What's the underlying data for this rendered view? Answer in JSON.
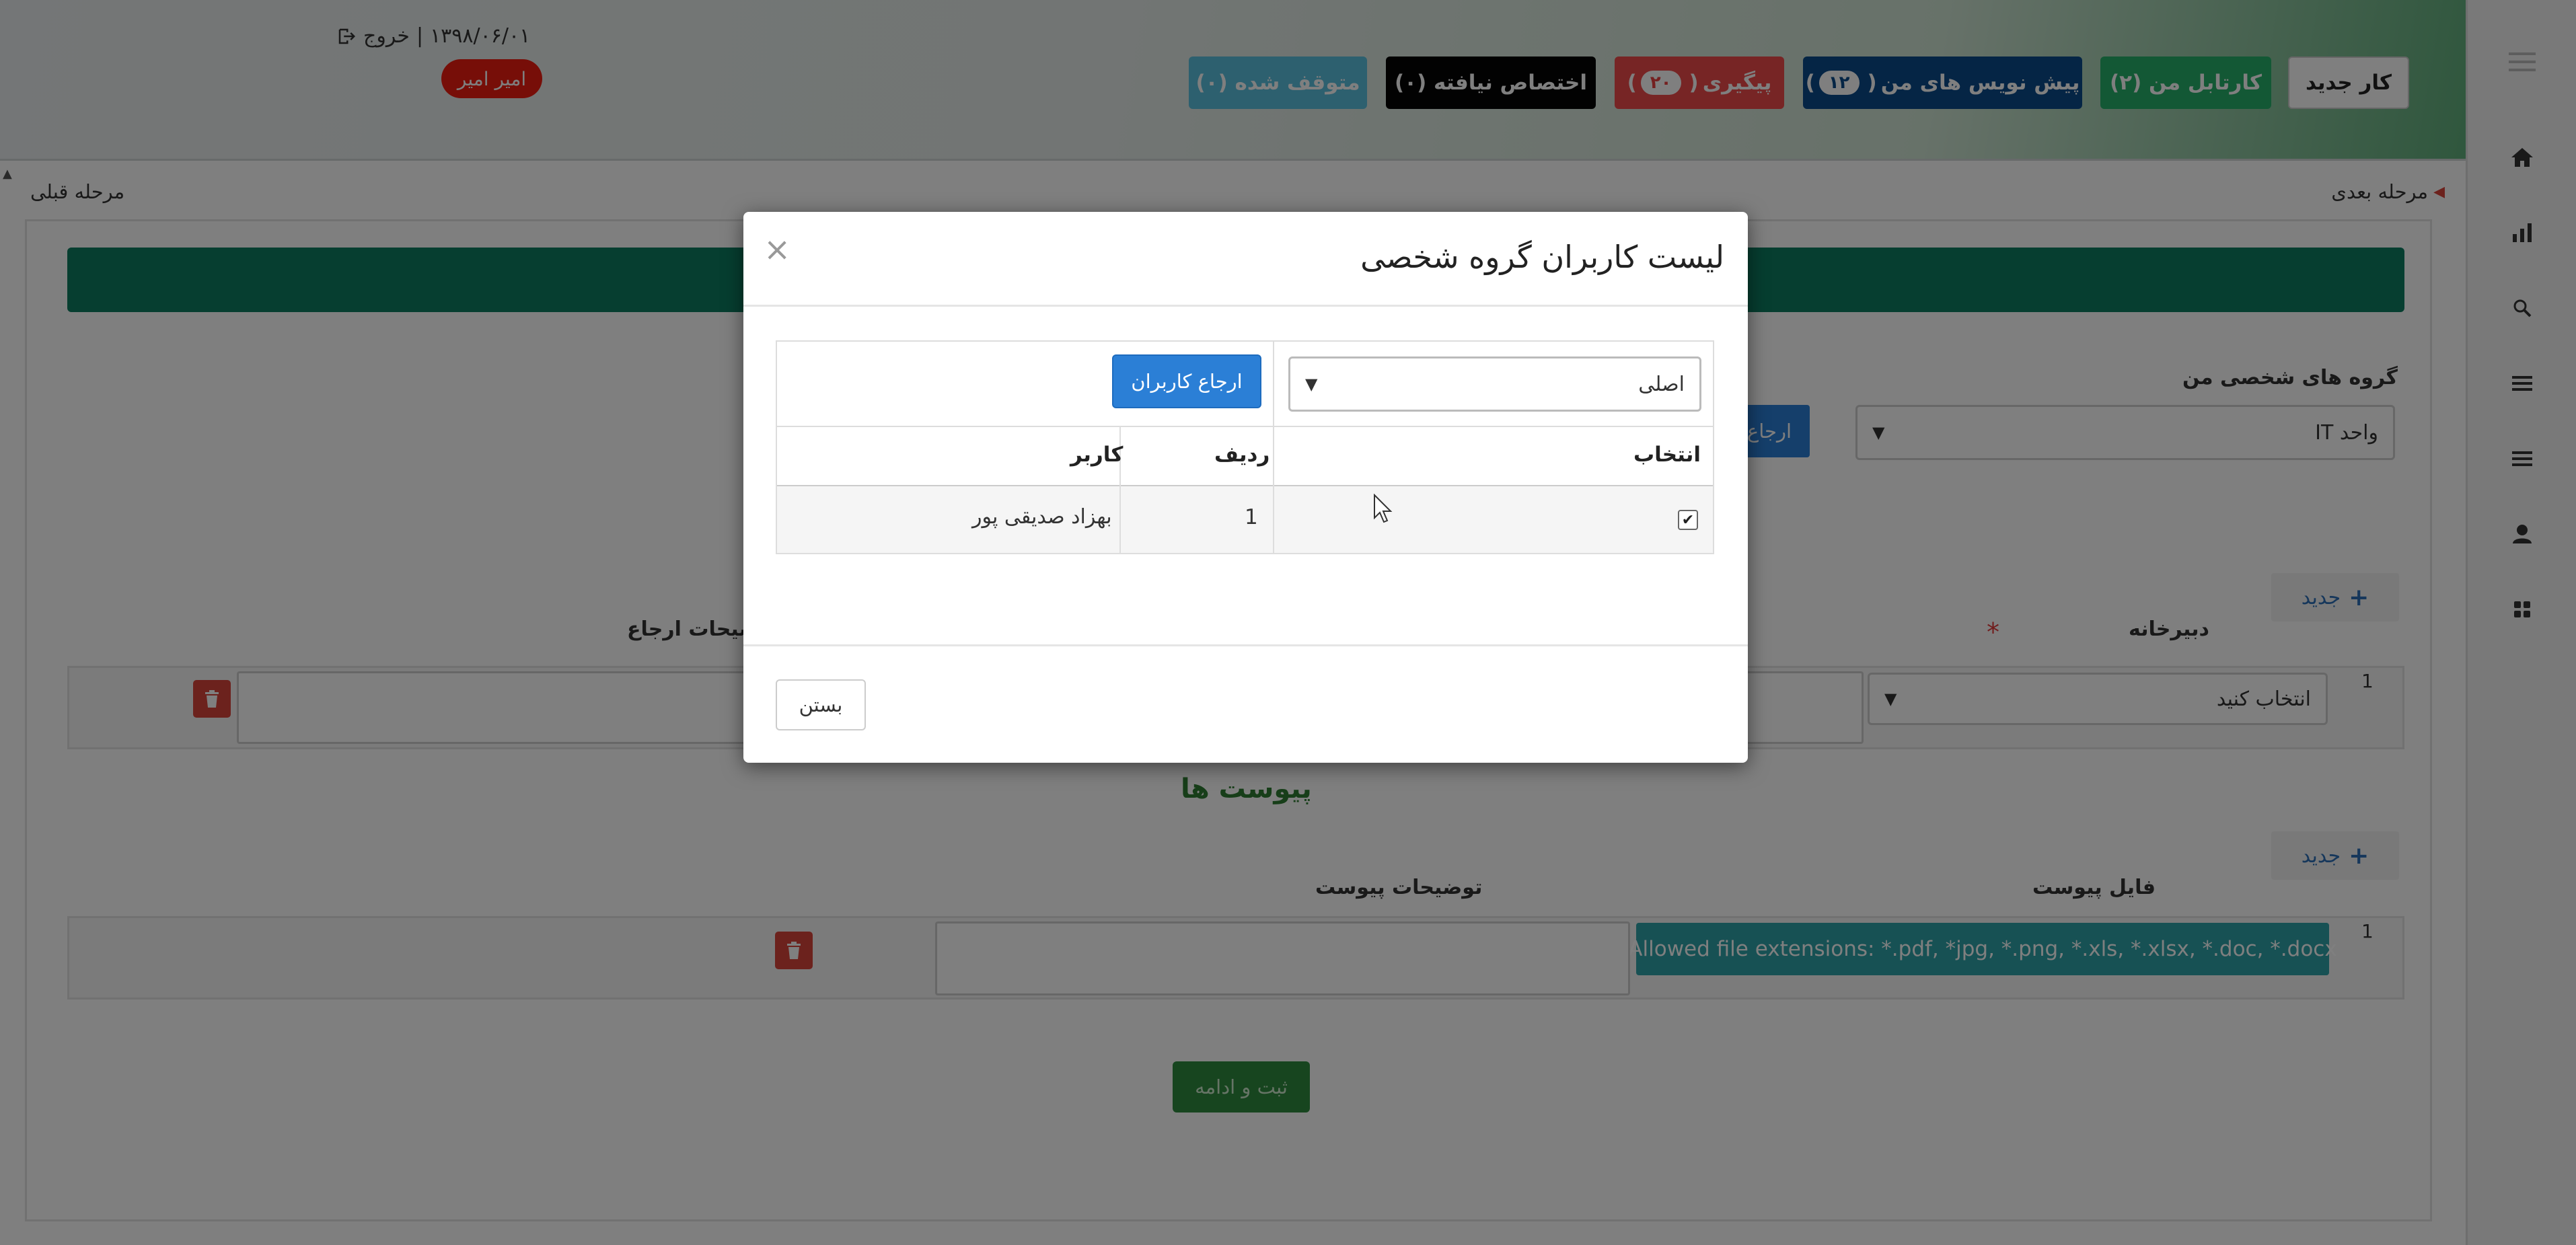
{
  "header": {
    "buttons": [
      {
        "label": "کار جدید",
        "bg": "#ffffff",
        "color": "#222222"
      },
      {
        "label": "کارتابل من (۲)",
        "bg": "#27b06a",
        "color": "#ffffff"
      },
      {
        "label": "پیش نویس های من",
        "count": "۱۲",
        "bg": "#0b4a8a",
        "color": "#ffffff"
      },
      {
        "label": "پیگیری",
        "count": "۲۰",
        "bg": "#ee4b4b",
        "color": "#ffffff"
      },
      {
        "label": "اختصاص نیافته (۰)",
        "bg": "#050505",
        "color": "#ffffff"
      },
      {
        "label": "متوقف شده (۰)",
        "bg": "#5bc0de",
        "color": "#ffffff"
      }
    ],
    "date": "۱۳۹۸/۰۶/۰۱",
    "separator": "|",
    "logout": "خروج",
    "user": "امیر امیر"
  },
  "sidebar": {
    "icons": [
      "menu-icon",
      "home-icon",
      "chart-icon",
      "search-icon",
      "list-icon",
      "list-icon-2",
      "user-icon",
      "grid-icon"
    ]
  },
  "nav": {
    "next": "مرحله بعدی",
    "prev": "مرحله قبلی"
  },
  "form": {
    "groups_label": "گروه های شخصی من",
    "groups_value": "واحد IT",
    "refer_partial": "ارجاع",
    "add_label": "جدید",
    "secretariat_label": "دبیرخانه",
    "referral_desc_label": "توضیحات ارجاع",
    "row_number": "1",
    "choose": "انتخاب کنید",
    "attachments_title": "پیوست ها",
    "attach_file_label": "فایل پیوست",
    "attach_desc_label": "توضیحات پیوست",
    "allowed_ext": "Allowed file extensions: *.pdf, *jpg, *.png, *.xls, *.xlsx, *.doc, *.docx",
    "submit": "ثبت و ادامه"
  },
  "modal": {
    "title": "لیست کاربران گروه شخصی",
    "close_symbol": "×",
    "dropdown_value": "اصلی",
    "refer_users": "ارجاع کاربران",
    "columns": {
      "select": "انتخاب",
      "row": "ردیف",
      "user": "کاربر"
    },
    "rows": [
      {
        "checked": true,
        "row": "1",
        "user": "بهزاد صدیقی پور"
      }
    ],
    "close_button": "بستن"
  }
}
